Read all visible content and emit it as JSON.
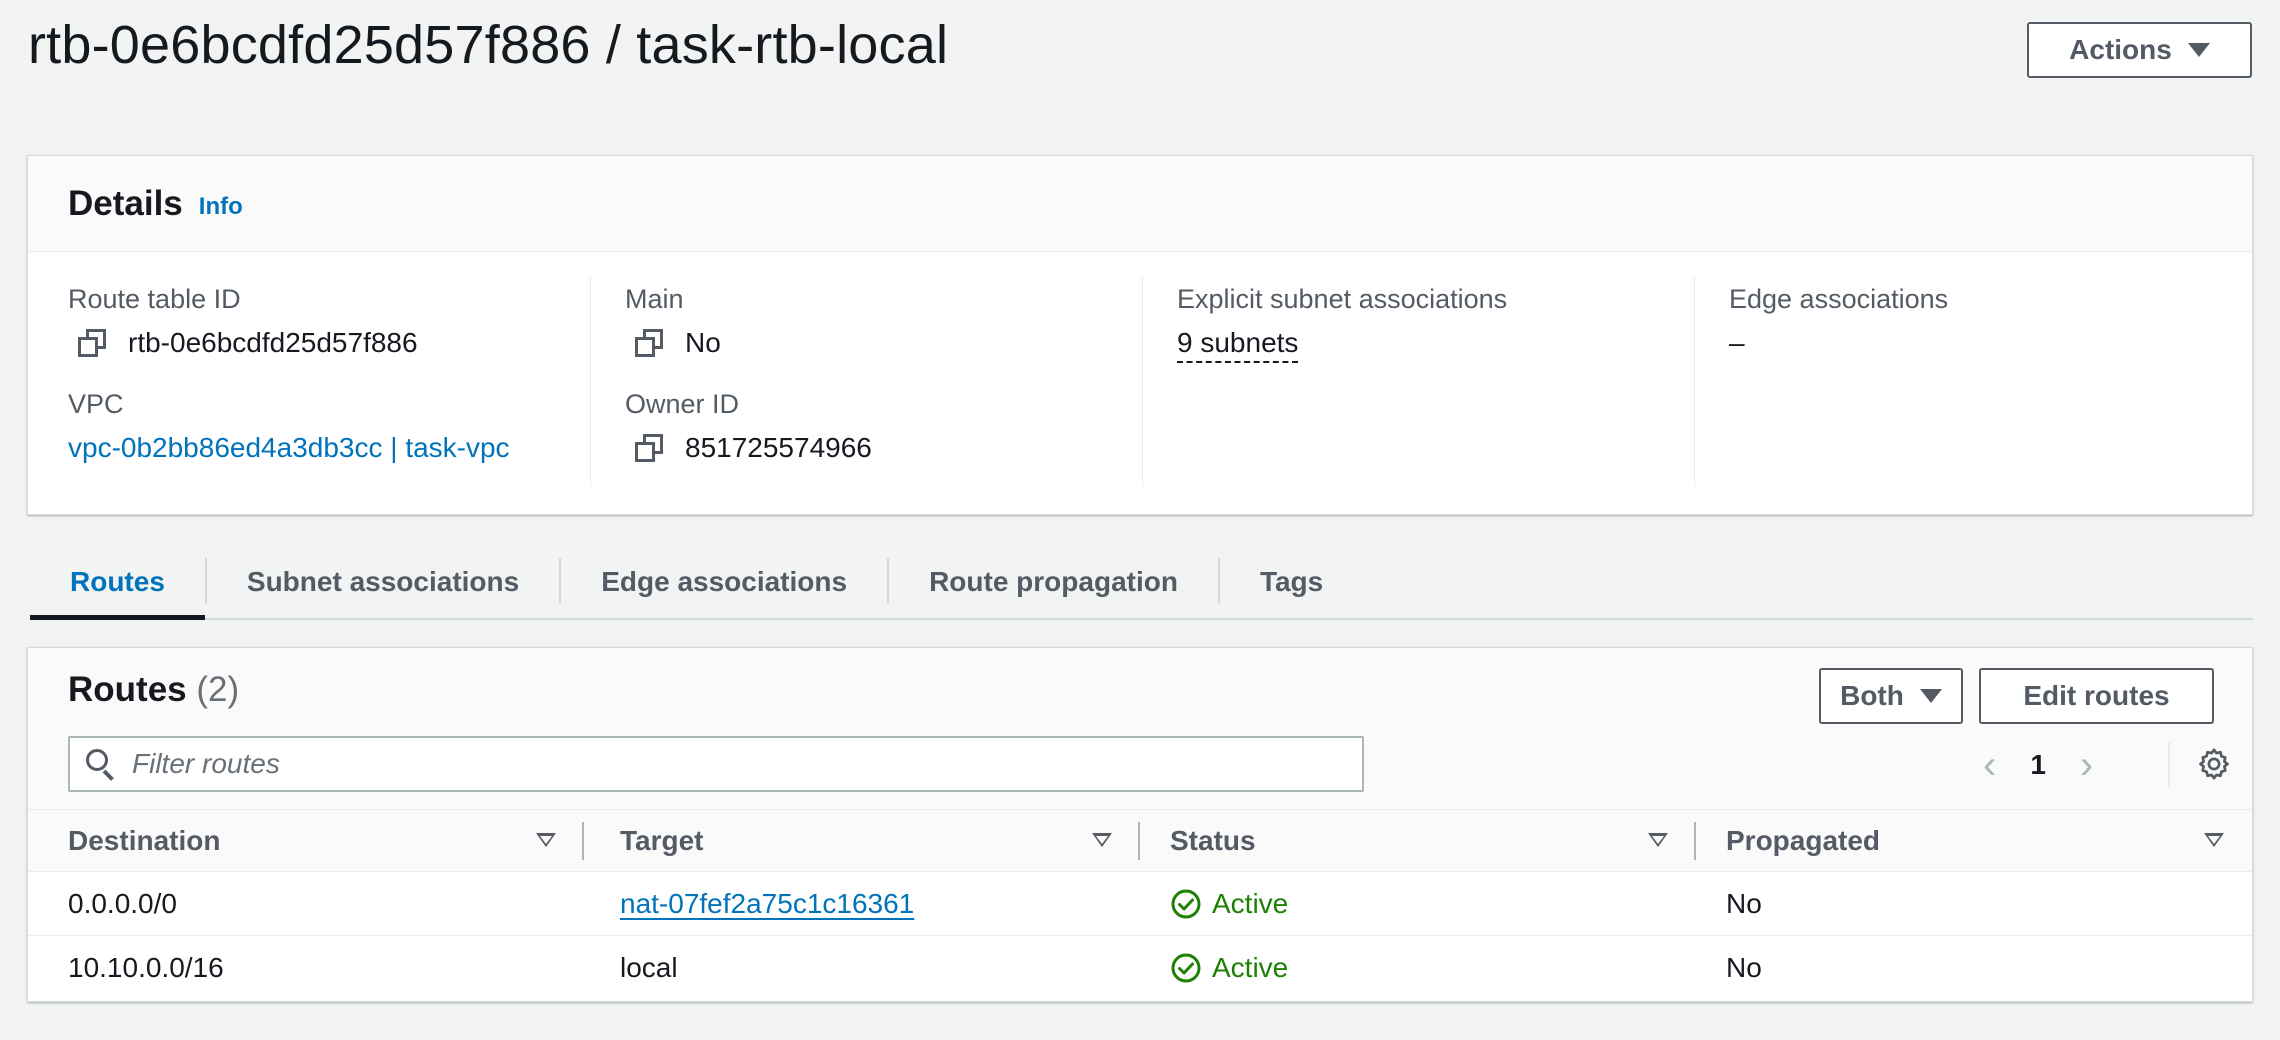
{
  "header": {
    "title": "rtb-0e6bcdfd25d57f886 / task-rtb-local",
    "actions_label": "Actions"
  },
  "details": {
    "title": "Details",
    "info_label": "Info",
    "route_table_id": {
      "label": "Route table ID",
      "value": "rtb-0e6bcdfd25d57f886"
    },
    "vpc": {
      "label": "VPC",
      "value": "vpc-0b2bb86ed4a3db3cc | task-vpc"
    },
    "main": {
      "label": "Main",
      "value": "No"
    },
    "owner_id": {
      "label": "Owner ID",
      "value": "851725574966"
    },
    "explicit_subnets": {
      "label": "Explicit subnet associations",
      "value": "9 subnets"
    },
    "edge_associations": {
      "label": "Edge associations",
      "value": "–"
    }
  },
  "tabs": [
    {
      "label": "Routes",
      "active": true
    },
    {
      "label": "Subnet associations",
      "active": false
    },
    {
      "label": "Edge associations",
      "active": false
    },
    {
      "label": "Route propagation",
      "active": false
    },
    {
      "label": "Tags",
      "active": false
    }
  ],
  "routes": {
    "title": "Routes",
    "count": "(2)",
    "filter_label": "Both",
    "edit_label": "Edit routes",
    "search_placeholder": "Filter routes",
    "page_number": "1",
    "columns": [
      "Destination",
      "Target",
      "Status",
      "Propagated"
    ],
    "rows": [
      {
        "destination": "0.0.0.0/0",
        "target": "nat-07fef2a75c1c16361",
        "target_is_link": true,
        "status": "Active",
        "propagated": "No"
      },
      {
        "destination": "10.10.0.0/16",
        "target": "local",
        "target_is_link": false,
        "status": "Active",
        "propagated": "No"
      }
    ]
  },
  "colors": {
    "link": "#0073bb",
    "success": "#1d8102",
    "text": "#16191f",
    "muted": "#545b64",
    "background": "#f2f3f3"
  },
  "icons": [
    "copy-icon",
    "search-icon",
    "gear-icon",
    "check-circle-icon",
    "chevron-left-icon",
    "chevron-right-icon",
    "caret-down-icon"
  ]
}
